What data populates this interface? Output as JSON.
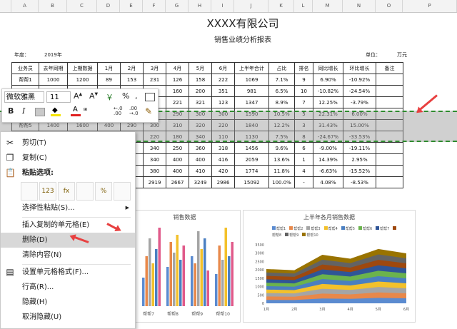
{
  "columns": [
    "A",
    "B",
    "C",
    "D",
    "E",
    "F",
    "G",
    "H",
    "I",
    "J",
    "K",
    "L",
    "M",
    "N",
    "O",
    "P"
  ],
  "title": "XXXX有限公司",
  "subtitle": "销售业绩分析报表",
  "year_label": "年度：",
  "year_value": "2019年",
  "unit_label": "单位：",
  "unit_value": "万元",
  "table": {
    "headers": [
      "业务员",
      "去年同期",
      "上期数据",
      "1月",
      "2月",
      "3月",
      "4月",
      "5月",
      "6月",
      "上半年合计",
      "占比",
      "排名",
      "同比增长",
      "环比增长",
      "备注"
    ],
    "rows": [
      [
        "帮帮1",
        "1000",
        "1200",
        "89",
        "153",
        "231",
        "126",
        "158",
        "222",
        "1069",
        "7.1%",
        "9",
        "6.90%",
        "-10.92%",
        ""
      ],
      [
        "",
        "",
        "",
        "",
        "",
        "",
        "160",
        "200",
        "351",
        "981",
        "6.5%",
        "10",
        "-10.82%",
        "-24.54%",
        ""
      ],
      [
        "",
        "",
        "",
        "",
        "",
        "",
        "221",
        "321",
        "123",
        "1347",
        "8.9%",
        "7",
        "12.25%",
        "-3.79%",
        ""
      ],
      [
        "",
        "",
        "",
        "",
        "",
        "",
        "290",
        "300",
        "300",
        "1590",
        "10.5%",
        "5",
        "22.31%",
        "6.00%",
        ""
      ],
      [
        "帮帮5",
        "1400",
        "1600",
        "400",
        "290",
        "300",
        "310",
        "320",
        "220",
        "1840",
        "12.2%",
        "3",
        "31.43%",
        "15.00%",
        ""
      ],
      [
        "",
        "",
        "",
        "",
        "",
        "220",
        "180",
        "340",
        "110",
        "1130",
        "7.5%",
        "8",
        "-24.67%",
        "-33.53%",
        ""
      ],
      [
        "",
        "",
        "",
        "",
        "",
        "340",
        "250",
        "360",
        "318",
        "1456",
        "9.6%",
        "6",
        "-9.00%",
        "-19.11%",
        ""
      ],
      [
        "",
        "",
        "",
        "",
        "",
        "340",
        "400",
        "400",
        "416",
        "2059",
        "13.6%",
        "1",
        "14.39%",
        "2.95%",
        ""
      ],
      [
        "",
        "",
        "",
        "",
        "",
        "380",
        "400",
        "410",
        "420",
        "1774",
        "11.8%",
        "4",
        "-6.63%",
        "-15.52%",
        ""
      ],
      [
        "",
        "",
        "",
        "",
        "",
        "2919",
        "2667",
        "3249",
        "2986",
        "15092",
        "100.0%",
        "-",
        "4.08%",
        "-8.53%",
        ""
      ]
    ]
  },
  "mini_toolbar": {
    "font": "微软雅黑",
    "size": "11",
    "bold": "B",
    "italic": "I",
    "percent": "%",
    "comma": ","
  },
  "context_menu": {
    "items": [
      {
        "label": "剪切(T)",
        "icon": "scissors-icon"
      },
      {
        "label": "复制(C)",
        "icon": "copy-icon"
      },
      {
        "label": "粘贴选项:",
        "icon": "paste-icon"
      },
      {
        "label": "选择性粘贴(S)...",
        "icon": ""
      },
      {
        "label": "插入复制的单元格(E)",
        "icon": ""
      },
      {
        "label": "删除(D)",
        "icon": ""
      },
      {
        "label": "清除内容(N)",
        "icon": ""
      },
      {
        "label": "设置单元格格式(F)...",
        "icon": "format-cells-icon"
      },
      {
        "label": "行高(R)...",
        "icon": ""
      },
      {
        "label": "隐藏(H)",
        "icon": ""
      },
      {
        "label": "取消隐藏(U)",
        "icon": ""
      }
    ],
    "paste_buttons": [
      "",
      "123",
      "fx",
      "",
      "%",
      ""
    ]
  },
  "charts": {
    "left_title": "销售数据",
    "left_x": [
      "帮帮7",
      "帮帮8",
      "帮帮9",
      "帮帮10"
    ],
    "right_title": "上半年各月销售数据",
    "right_legend": [
      "帮帮1",
      "帮帮2",
      "帮帮3",
      "帮帮4",
      "帮帮5",
      "帮帮6",
      "帮帮7",
      "帮帮8",
      "帮帮9",
      "帮帮10"
    ],
    "right_y": [
      "3500",
      "3000",
      "2500",
      "2000",
      "1500",
      "1000",
      "500",
      "0"
    ],
    "right_x": [
      "1月",
      "2月",
      "3月",
      "4月",
      "5月",
      "6月"
    ]
  },
  "chart_data": {
    "type": "area",
    "title": "上半年各月销售数据",
    "categories": [
      "1月",
      "2月",
      "3月",
      "4月",
      "5月",
      "6月"
    ],
    "ylim": [
      0,
      3500
    ],
    "series_total": [
      2050,
      1980,
      2900,
      2667,
      3249,
      2986
    ]
  }
}
